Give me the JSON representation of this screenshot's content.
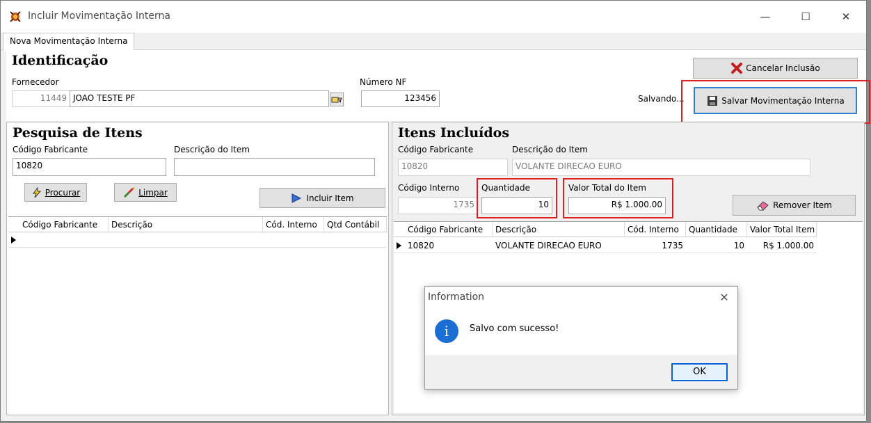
{
  "window": {
    "title": "Incluir Movimentação Interna",
    "minimize": "—",
    "maximize": "☐",
    "close": "✕"
  },
  "tabs": [
    {
      "label": "Nova Movimentação Interna"
    }
  ],
  "identificacao": {
    "heading": "Identificação",
    "fornecedor_label": "Fornecedor",
    "fornecedor_code": "11449",
    "fornecedor_name": "JOAO TESTE PF",
    "numero_nf_label": "Número NF",
    "numero_nf": "123456",
    "status_text": "Salvando...",
    "cancel_label": "Cancelar Inclusão",
    "save_label": "Salvar Movimentação Interna"
  },
  "pesquisa": {
    "heading": "Pesquisa de Itens",
    "codigo_label": "Código Fabricante",
    "codigo_value": "10820",
    "descricao_label": "Descrição do Item",
    "descricao_value": "",
    "procurar_label": "Procurar",
    "limpar_label": "Limpar",
    "incluir_label": "Incluir Item",
    "grid_columns": [
      "Código Fabricante",
      "Descrição",
      "Cód. Interno",
      "Qtd Contábil"
    ]
  },
  "incluidos": {
    "heading": "Itens Incluídos",
    "codigo_label": "Código Fabricante",
    "codigo_value": "10820",
    "descricao_label": "Descrição  do Item",
    "descricao_value": "VOLANTE DIRECAO EURO",
    "interno_label": "Código Interno",
    "interno_value": "1735",
    "quantidade_label": "Quantidade",
    "quantidade_value": "10",
    "valor_label": "Valor Total do Item",
    "valor_value": "R$ 1.000.00",
    "remover_label": "Remover Item",
    "grid_columns": [
      "Código Fabricante",
      "Descrição",
      "Cód. Interno",
      "Quantidade",
      "Valor Total Item"
    ],
    "rows": [
      [
        "10820",
        "VOLANTE DIRECAO EURO",
        "1735",
        "10",
        "R$ 1.000.00"
      ]
    ]
  },
  "dialog": {
    "title": "Information",
    "message": "Salvo com sucesso!",
    "ok_label": "OK",
    "icon": "i"
  },
  "colors": {
    "highlight": "#e02020",
    "focus": "#2f7fd6",
    "info": "#1b6fd2"
  }
}
